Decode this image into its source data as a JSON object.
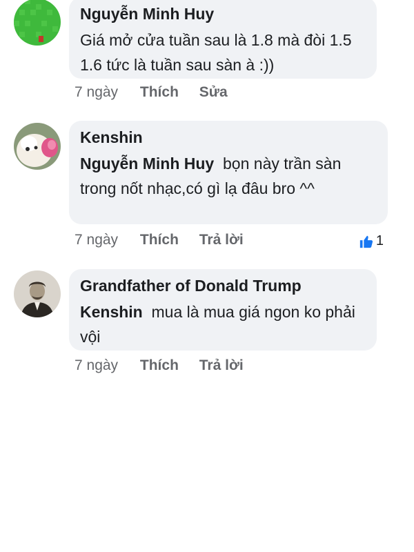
{
  "comments": [
    {
      "author": "Nguyễn Minh Huy",
      "mention": "",
      "text": "Giá mở cửa tuần sau là 1.8 mà đòi 1.5 1.6 tức là tuần sau sàn à :))",
      "time": "7 ngày",
      "like_label": "Thích",
      "secondary_label": "Sửa"
    },
    {
      "author": "Kenshin",
      "mention": "Nguyễn Minh Huy",
      "text": "bọn này trần sàn trong nốt nhạc,có gì lạ đâu bro ^^",
      "time": "7 ngày",
      "like_label": "Thích",
      "secondary_label": "Trả lời",
      "reaction_count": "1"
    },
    {
      "author": "Grandfather of Donald Trump",
      "mention": "Kenshin",
      "text": "mua là mua giá ngon ko phải vội",
      "time": "7 ngày",
      "like_label": "Thích",
      "secondary_label": "Trả lời"
    }
  ],
  "colors": {
    "bubble": "#f0f2f5",
    "meta_text": "#65676b",
    "like_blue": "#1877f2"
  }
}
